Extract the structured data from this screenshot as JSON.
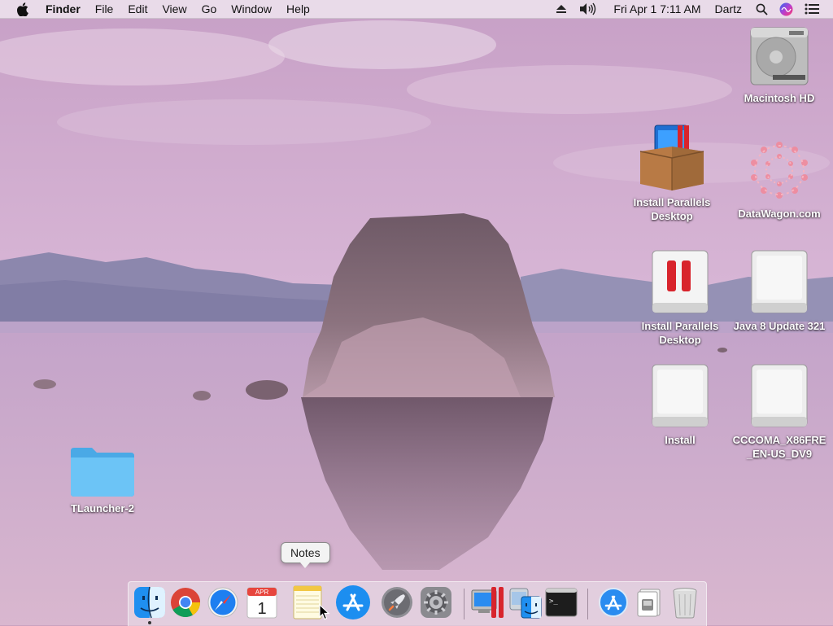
{
  "menubar": {
    "app_name": "Finder",
    "menus": [
      "File",
      "Edit",
      "View",
      "Go",
      "Window",
      "Help"
    ],
    "datetime": "Fri Apr 1  7:11 AM",
    "user": "Dartz"
  },
  "desktop_icons": {
    "macintosh_hd": "Macintosh HD",
    "parallels_package": "Install Parallels Desktop",
    "datawagon": "DataWagon.com",
    "parallels_disk": "Install Parallels Desktop",
    "java": "Java 8 Update 321",
    "install": "Install",
    "cccoma": "CCCOMA_X86FRE_EN-US_DV9",
    "tlauncher": "TLauncher-2"
  },
  "dock": {
    "tooltip": "Notes",
    "calendar_month": "APR",
    "calendar_day": "1",
    "terminal_prompt": ">_"
  },
  "colors": {
    "menubar_bg": "#f0e8f0",
    "folder_blue": "#5ab8ee",
    "parallels_red": "#d8242c",
    "chrome_red": "#db4437",
    "chrome_yellow": "#f4c20d",
    "chrome_green": "#0f9d58",
    "safari_blue": "#1e7ff0"
  }
}
